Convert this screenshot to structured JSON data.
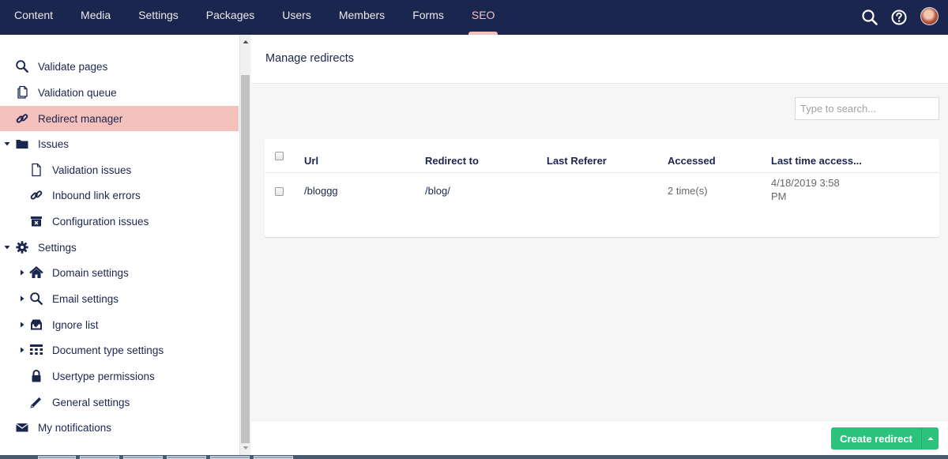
{
  "topnav": {
    "items": [
      {
        "label": "Content"
      },
      {
        "label": "Media"
      },
      {
        "label": "Settings"
      },
      {
        "label": "Packages"
      },
      {
        "label": "Users"
      },
      {
        "label": "Members"
      },
      {
        "label": "Forms"
      },
      {
        "label": "SEO",
        "active": true
      }
    ],
    "right_icons": [
      "search-icon",
      "help-icon",
      "user-avatar"
    ]
  },
  "sidebar": {
    "items": [
      {
        "label": "Validate pages",
        "icon": "search-icon"
      },
      {
        "label": "Validation queue",
        "icon": "document-queue-icon"
      },
      {
        "label": "Redirect manager",
        "icon": "link-icon",
        "selected": true
      },
      {
        "label": "Issues",
        "icon": "folder-icon",
        "expanded": true
      },
      {
        "label": "Validation issues",
        "icon": "document-icon"
      },
      {
        "label": "Inbound link errors",
        "icon": "link-icon"
      },
      {
        "label": "Configuration issues",
        "icon": "box-icon"
      },
      {
        "label": "Settings",
        "icon": "gear-icon",
        "expanded": true
      },
      {
        "label": "Domain settings",
        "icon": "home-icon",
        "collapsed": true
      },
      {
        "label": "Email settings",
        "icon": "search-icon",
        "collapsed": true
      },
      {
        "label": "Ignore list",
        "icon": "inbox-icon",
        "collapsed": true
      },
      {
        "label": "Document type settings",
        "icon": "grid-icon",
        "collapsed": true
      },
      {
        "label": "Usertype permissions",
        "icon": "lock-icon"
      },
      {
        "label": "General settings",
        "icon": "pencil-icon"
      },
      {
        "label": "My notifications",
        "icon": "envelope-icon"
      }
    ]
  },
  "main": {
    "title": "Manage redirects",
    "search_placeholder": "Type to search...",
    "table": {
      "columns": [
        "Url",
        "Redirect to",
        "Last Referer",
        "Accessed",
        "Last time access..."
      ],
      "rows": [
        {
          "url": "/bloggg",
          "redirect_to": "/blog/",
          "last_referer": "",
          "accessed": "2 time(s)",
          "last_access": "4/18/2019 3:58 PM"
        }
      ]
    },
    "create_button": "Create redirect"
  },
  "colors": {
    "header_bg": "#1b264f",
    "active_accent": "#f5c1bc",
    "button_green": "#2bc37c"
  }
}
